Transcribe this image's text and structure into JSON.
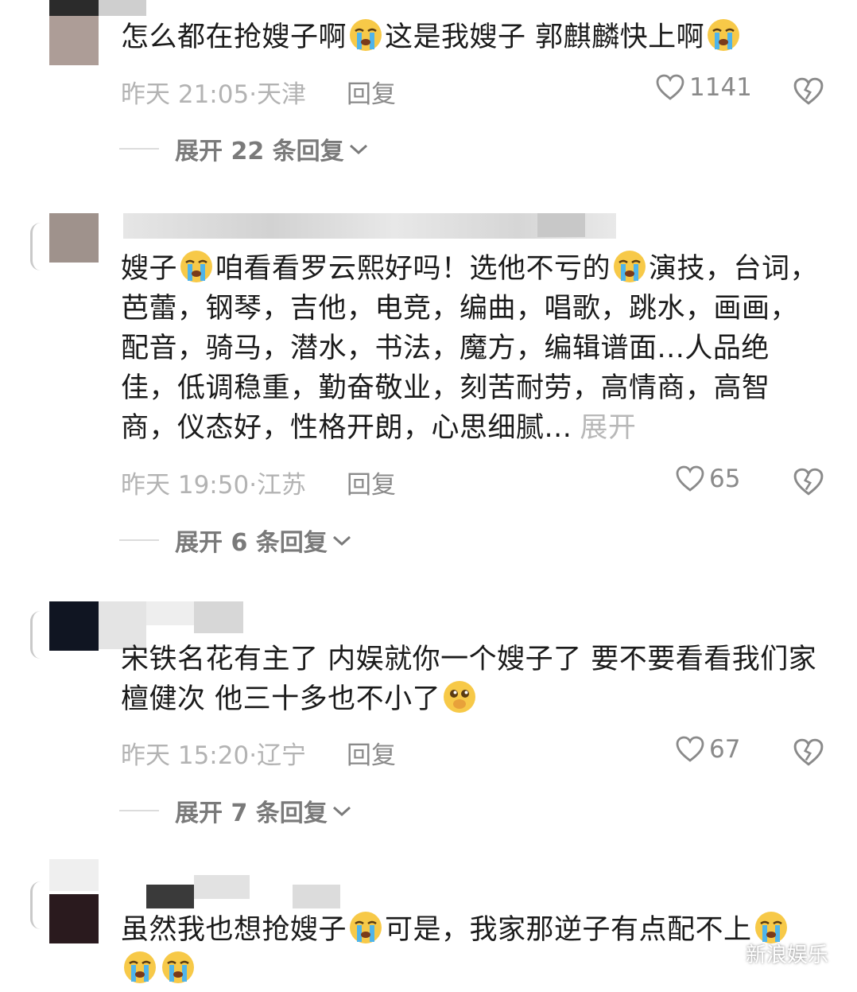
{
  "comments": [
    {
      "text": "怎么都在抢嫂子啊😭这是我嫂子 郭麒麟快上啊😭",
      "time": "昨天 21:05",
      "location": "天津",
      "reply_label": "回复",
      "likes": "1141",
      "more_replies": "展开 22 条回复"
    },
    {
      "text": "嫂子😭咱看看罗云熙好吗！选他不亏的😭演技，台词，芭蕾，钢琴，吉他，电竞，编曲，唱歌，跳水，画画，配音，骑马，潜水，书法，魔方，编辑谱面...人品绝佳，低调稳重，勤奋敬业，刻苦耐劳，高情商，高智商，仪态好，性格开朗，心思细腻...",
      "expand_label": "展开",
      "time": "昨天 19:50",
      "location": "江苏",
      "reply_label": "回复",
      "likes": "65",
      "more_replies": "展开 6 条回复"
    },
    {
      "text": "宋铁名花有主了 内娱就你一个嫂子了 要不要看看我们家檀健次 他三十多也不小了🥺",
      "time": "昨天 15:20",
      "location": "辽宁",
      "reply_label": "回复",
      "likes": "67",
      "more_replies": "展开 7 条回复"
    },
    {
      "text": "虽然我也想抢嫂子😭可是，我家那逆子有点配不上😭😭😭"
    }
  ],
  "watermark": "新浪娱乐",
  "icons": [
    "heart-icon",
    "broken-heart-icon",
    "chevron-down-icon",
    "crying-emoji",
    "pleading-emoji",
    "wechat-logo"
  ],
  "colors": {
    "meta_gray": "#b3b3b3",
    "emoji_yellow": "#f7c948",
    "tear_blue": "#4fb4ea"
  }
}
